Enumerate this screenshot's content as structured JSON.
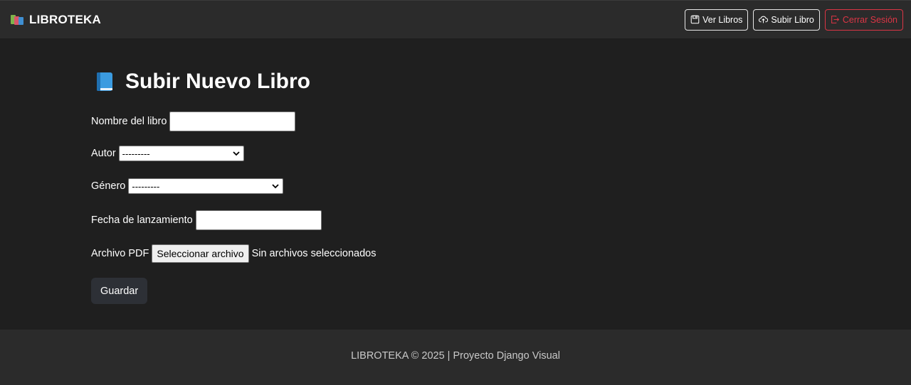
{
  "navbar": {
    "brand": "LIBROTEKA",
    "buttons": [
      {
        "label": "Ver Libros",
        "icon": "floppy-icon"
      },
      {
        "label": "Subir Libro",
        "icon": "cloud-upload-icon"
      },
      {
        "label": "Cerrar Sesión",
        "icon": "logout-icon",
        "color": "#dc3545"
      }
    ]
  },
  "page": {
    "title": "Subir Nuevo Libro",
    "title_icon": "blue-book-icon"
  },
  "form": {
    "nombre": {
      "label": "Nombre del libro",
      "value": ""
    },
    "autor": {
      "label": "Autor",
      "selected": "---------"
    },
    "genero": {
      "label": "Género",
      "selected": "---------"
    },
    "fecha": {
      "label": "Fecha de lanzamiento",
      "value": ""
    },
    "archivo": {
      "label": "Archivo PDF",
      "button": "Seleccionar archivo",
      "status": "Sin archivos seleccionados"
    },
    "submit": "Guardar"
  },
  "footer": {
    "text": "LIBROTEKA © 2025 | Proyecto Django Visual"
  },
  "colors": {
    "background": "#1f1f1f",
    "navbar": "#2b2b2b",
    "danger": "#dc3545",
    "primary_button": "#2d3036"
  }
}
